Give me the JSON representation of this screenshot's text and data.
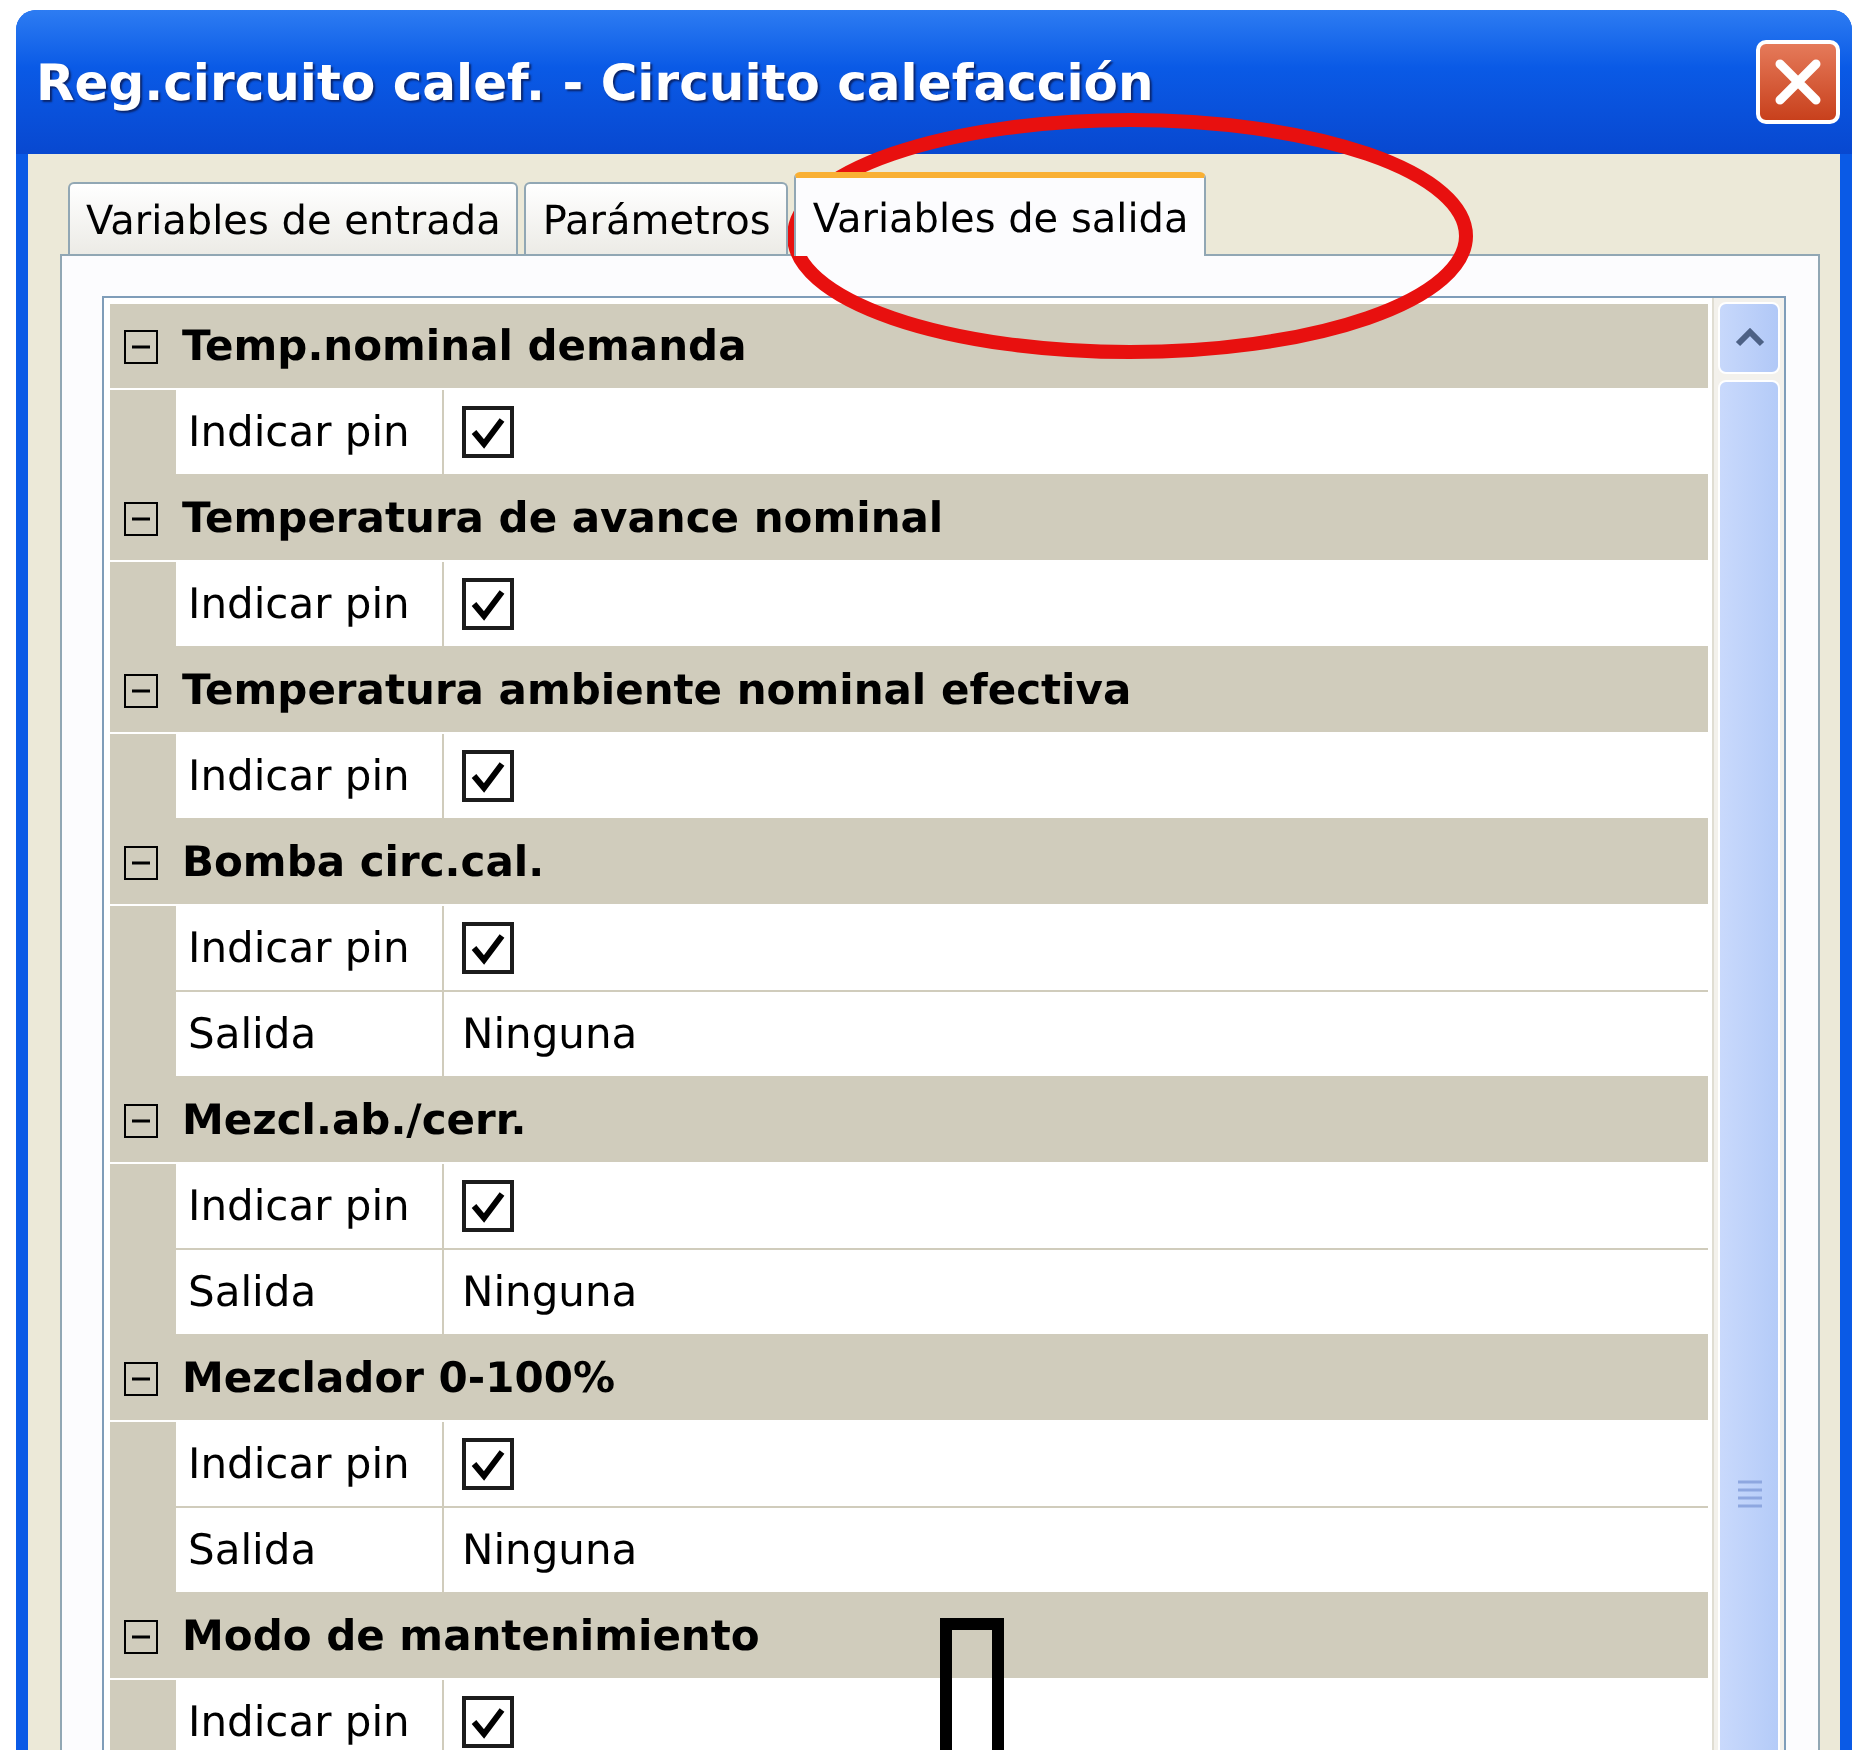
{
  "window": {
    "title": "Reg.circuito calef. - Circuito calefacción"
  },
  "tabs": [
    {
      "label": "Variables de entrada",
      "selected": false
    },
    {
      "label": "Parámetros",
      "selected": false
    },
    {
      "label": "Variables de salida",
      "selected": true
    }
  ],
  "sections": [
    {
      "title": "Temp.nominal demanda",
      "expanded": true,
      "rows": [
        {
          "kind": "checkbox",
          "label": "Indicar pin",
          "checked": true
        }
      ]
    },
    {
      "title": "Temperatura de avance nominal",
      "expanded": true,
      "rows": [
        {
          "kind": "checkbox",
          "label": "Indicar pin",
          "checked": true
        }
      ]
    },
    {
      "title": "Temperatura ambiente nominal efectiva",
      "expanded": true,
      "rows": [
        {
          "kind": "checkbox",
          "label": "Indicar pin",
          "checked": true
        }
      ]
    },
    {
      "title": "Bomba circ.cal.",
      "expanded": true,
      "rows": [
        {
          "kind": "checkbox",
          "label": "Indicar pin",
          "checked": true
        },
        {
          "kind": "value",
          "label": "Salida",
          "value": "Ninguna"
        }
      ]
    },
    {
      "title": "Mezcl.ab./cerr.",
      "expanded": true,
      "rows": [
        {
          "kind": "checkbox",
          "label": "Indicar pin",
          "checked": true
        },
        {
          "kind": "value",
          "label": "Salida",
          "value": "Ninguna"
        }
      ]
    },
    {
      "title": "Mezclador 0-100%",
      "expanded": true,
      "rows": [
        {
          "kind": "checkbox",
          "label": "Indicar pin",
          "checked": true
        },
        {
          "kind": "value",
          "label": "Salida",
          "value": "Ninguna"
        }
      ]
    },
    {
      "title": "Modo de mantenimiento",
      "expanded": true,
      "rows": [
        {
          "kind": "checkbox",
          "label": "Indicar pin",
          "checked": true
        }
      ]
    }
  ]
}
